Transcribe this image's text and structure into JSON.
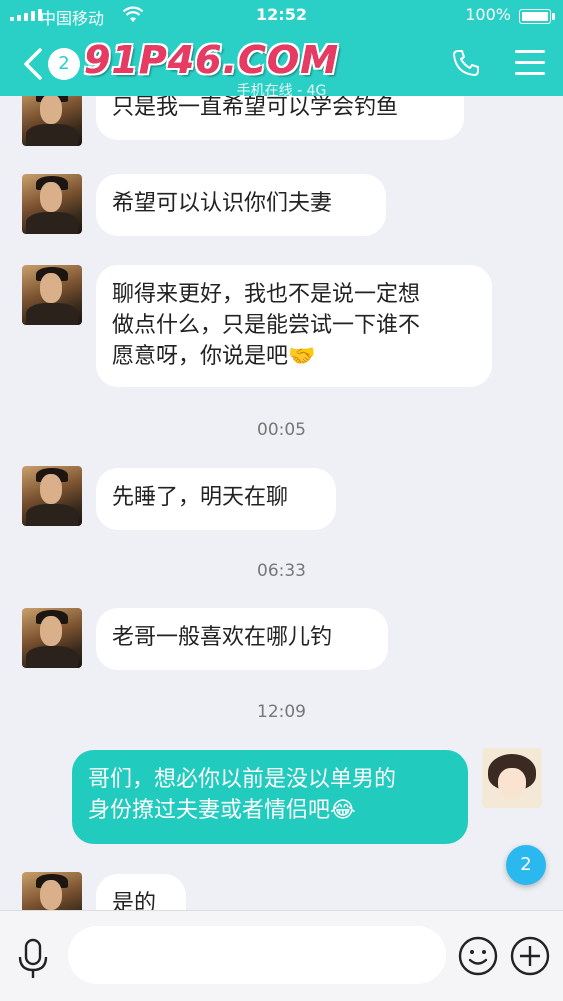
{
  "status_bar": {
    "carrier": "中国移动",
    "time": "12:52",
    "battery": "100%"
  },
  "nav": {
    "back_badge": "2",
    "title_watermark": "91P46.COM",
    "subtitle": "手机在线 - 4G",
    "icons": [
      "back-chevron-icon",
      "phone-icon",
      "menu-icon"
    ],
    "accent_color": "#2ad0c6"
  },
  "messages": [
    {
      "type": "incoming",
      "text": "只是我一直希望可以学会钓鱼"
    },
    {
      "type": "incoming",
      "text": "希望可以认识你们夫妻"
    },
    {
      "type": "incoming",
      "text": "聊得来更好，我也不是说一定想\n做点什么，只是能尝试一下谁不\n愿意呀，你说是吧🤝"
    },
    {
      "type": "timestamp",
      "text": "00:05"
    },
    {
      "type": "incoming",
      "text": "先睡了，明天在聊"
    },
    {
      "type": "timestamp",
      "text": "06:33"
    },
    {
      "type": "incoming",
      "text": "老哥一般喜欢在哪儿钓"
    },
    {
      "type": "timestamp",
      "text": "12:09"
    },
    {
      "type": "outgoing",
      "text": "哥们，想必你以前是没以单男的\n身份撩过夫妻或者情侣吧😂"
    },
    {
      "type": "incoming",
      "text": "是的"
    }
  ],
  "floating_badge": "2",
  "input_bar": {
    "placeholder": "",
    "icons": [
      "microphone-icon",
      "emoji-icon",
      "plus-icon"
    ]
  }
}
